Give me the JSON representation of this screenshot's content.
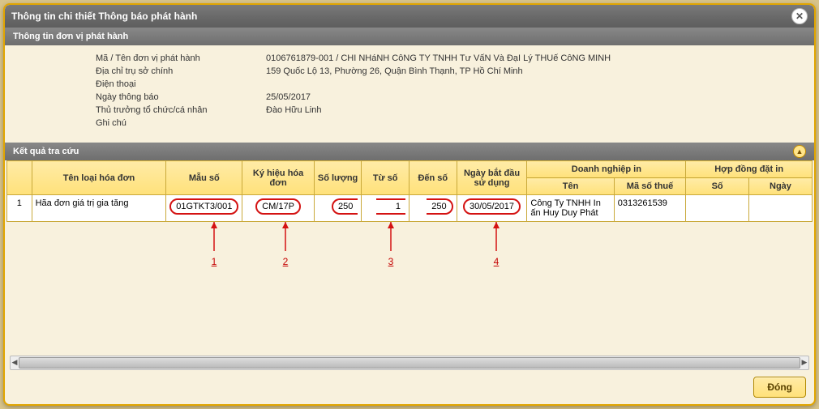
{
  "title": "Thông tin chi thiết Thông báo phát hành",
  "section1": {
    "header": "Thông tin đơn vị phát hành"
  },
  "info": {
    "rows": [
      {
        "label": "Mã / Tên đơn vị phát hành",
        "value": "0106761879-001 / CHI NHáNH CôNG TY TNHH Tư VấN Và ĐạI Lý THUế CôNG MINH"
      },
      {
        "label": "Địa chỉ trụ sở chính",
        "value": "159 Quốc Lộ 13, Phường 26, Quận Bình Thạnh, TP Hồ Chí Minh"
      },
      {
        "label": "Điện thoại",
        "value": ""
      },
      {
        "label": "Ngày thông báo",
        "value": "25/05/2017"
      },
      {
        "label": "Thủ trưởng tổ chức/cá nhân",
        "value": "Đào Hữu Linh"
      },
      {
        "label": "Ghi chú",
        "value": ""
      }
    ]
  },
  "section2": {
    "header": "Kết quả tra cứu"
  },
  "table": {
    "headers": {
      "idx": "",
      "ten": "Tên loại hóa đơn",
      "mau": "Mẫu số",
      "kyhieu": "Ký hiệu hóa đơn",
      "soluong": "Số lượng",
      "tuso": "Từ số",
      "denso": "Đến số",
      "ngaybd": "Ngày bắt đầu sử dụng",
      "dn": "Doanh nghiệp in",
      "dn_ten": "Tên",
      "dn_mst": "Mã số thuế",
      "hd": "Hợp đồng đặt in",
      "hd_so": "Số",
      "hd_ngay": "Ngày"
    },
    "row": {
      "idx": "1",
      "ten": "Hãa đơn giá trị gia tăng",
      "mau": "01GTKT3/001",
      "kyhieu": "CM/17P",
      "soluong": "250",
      "tuso": "1",
      "denso": "250",
      "ngaybd": "30/05/2017",
      "dn_ten": "Công Ty TNHH In ấn Huy Duy Phát",
      "dn_mst": "0313261539",
      "hd_so": "",
      "hd_ngay": ""
    }
  },
  "callouts": {
    "c1": "1",
    "c2": "2",
    "c3": "3",
    "c4": "4"
  },
  "buttons": {
    "close": "Đóng"
  }
}
